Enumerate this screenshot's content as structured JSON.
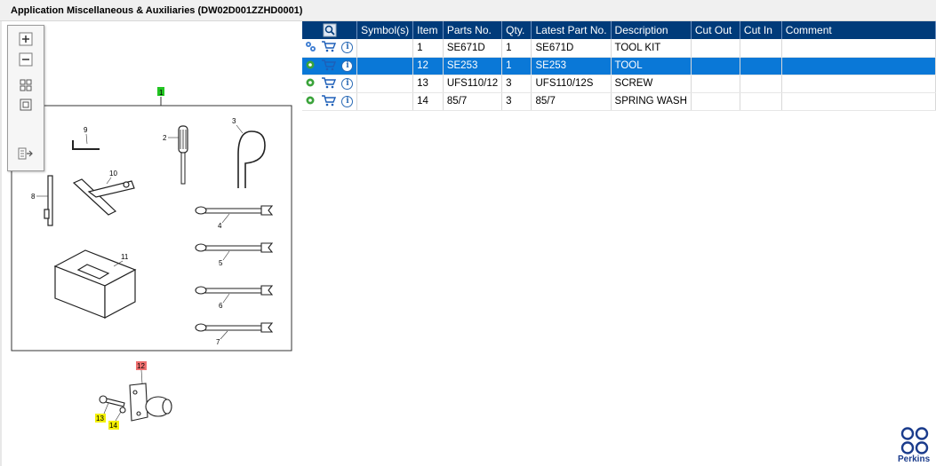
{
  "window": {
    "title": "Application Miscellaneous & Auxiliaries (DW02D001ZZHD0001)"
  },
  "toolbar": {
    "zoom_in": "zoom-in-icon",
    "zoom_out": "zoom-out-icon",
    "fit_all": "fit-all-icon",
    "fit_window": "fit-window-icon",
    "export": "export-icon"
  },
  "drawing": {
    "callouts": [
      "1",
      "2",
      "3",
      "4",
      "5",
      "6",
      "7",
      "8",
      "9",
      "10",
      "11",
      "12",
      "13",
      "14"
    ],
    "highlight_colors": {
      "green": "#22c422",
      "red": "#f07070",
      "yellow": "#f3f000"
    }
  },
  "table": {
    "columns": [
      "Symbol(s)",
      "Item",
      "Parts No.",
      "Qty.",
      "Latest Part No.",
      "Description",
      "Cut Out",
      "Cut In",
      "Comment"
    ],
    "rows": [
      {
        "item": "1",
        "parts_no": "SE671D",
        "qty": "1",
        "latest": "SE671D",
        "description": "TOOL KIT",
        "cut_out": "",
        "cut_in": "",
        "comment": "",
        "selected": false,
        "icon": "gears-icon"
      },
      {
        "item": "12",
        "parts_no": "SE253",
        "qty": "1",
        "latest": "SE253",
        "description": "TOOL",
        "cut_out": "",
        "cut_in": "",
        "comment": "",
        "selected": true,
        "icon": "gear-icon"
      },
      {
        "item": "13",
        "parts_no": "UFS110/12",
        "qty": "3",
        "latest": "UFS110/12S",
        "description": "SCREW",
        "cut_out": "",
        "cut_in": "",
        "comment": "",
        "selected": false,
        "icon": "gear-icon"
      },
      {
        "item": "14",
        "parts_no": "85/7",
        "qty": "3",
        "latest": "85/7",
        "description": "SPRING WASH",
        "cut_out": "",
        "cut_in": "",
        "comment": "",
        "selected": false,
        "icon": "gear-icon"
      }
    ]
  },
  "colors": {
    "header_bg": "#003b7a",
    "selected_row": "#0a78d7",
    "brand": "#1b3c8c"
  },
  "brand": {
    "name": "Perkins"
  }
}
